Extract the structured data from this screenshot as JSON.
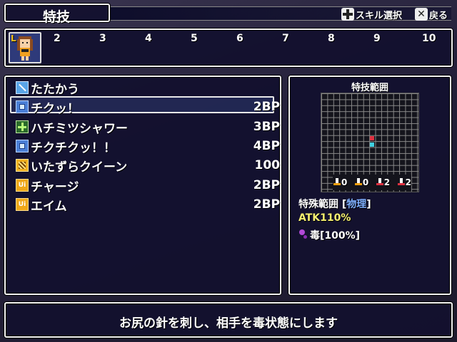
{
  "title": "特技",
  "hints": {
    "select_label": "スキル選択",
    "back_label": "戻る"
  },
  "party": {
    "slot1_tag": "L",
    "slot_numbers": [
      "2",
      "3",
      "4",
      "5",
      "6",
      "7",
      "8",
      "9",
      "10"
    ]
  },
  "skills": [
    {
      "name": "たたかう",
      "cost": "",
      "icon": "sword-icon"
    },
    {
      "name": "チクッ！",
      "cost": "2BP",
      "icon": "skill-icon"
    },
    {
      "name": "ハチミツシャワー",
      "cost": "3BP",
      "icon": "heal-icon"
    },
    {
      "name": "チクチクッ！！",
      "cost": "4BP",
      "icon": "skill-icon"
    },
    {
      "name": "いたずらクイーン",
      "cost": "100",
      "icon": "special-icon"
    },
    {
      "name": "チャージ",
      "cost": "2BP",
      "icon": "buff-icon"
    },
    {
      "name": "エイム",
      "cost": "2BP",
      "icon": "buff-icon"
    }
  ],
  "selected_index": 1,
  "range_panel": {
    "title": "特技範囲",
    "stats": [
      "0",
      "0",
      "2",
      "2"
    ],
    "range_label": "特殊範囲",
    "range_type": "物理",
    "atk": "ATK110%",
    "status_effect": "毒[100%]",
    "colors": {
      "target": "#e03040",
      "self": "#40d0e0"
    }
  },
  "description": "お尻の針を刺し、相手を毒状態にします",
  "colors": {
    "accent_yellow": "#f5ef70",
    "physical_blue": "#7fb0ff"
  }
}
